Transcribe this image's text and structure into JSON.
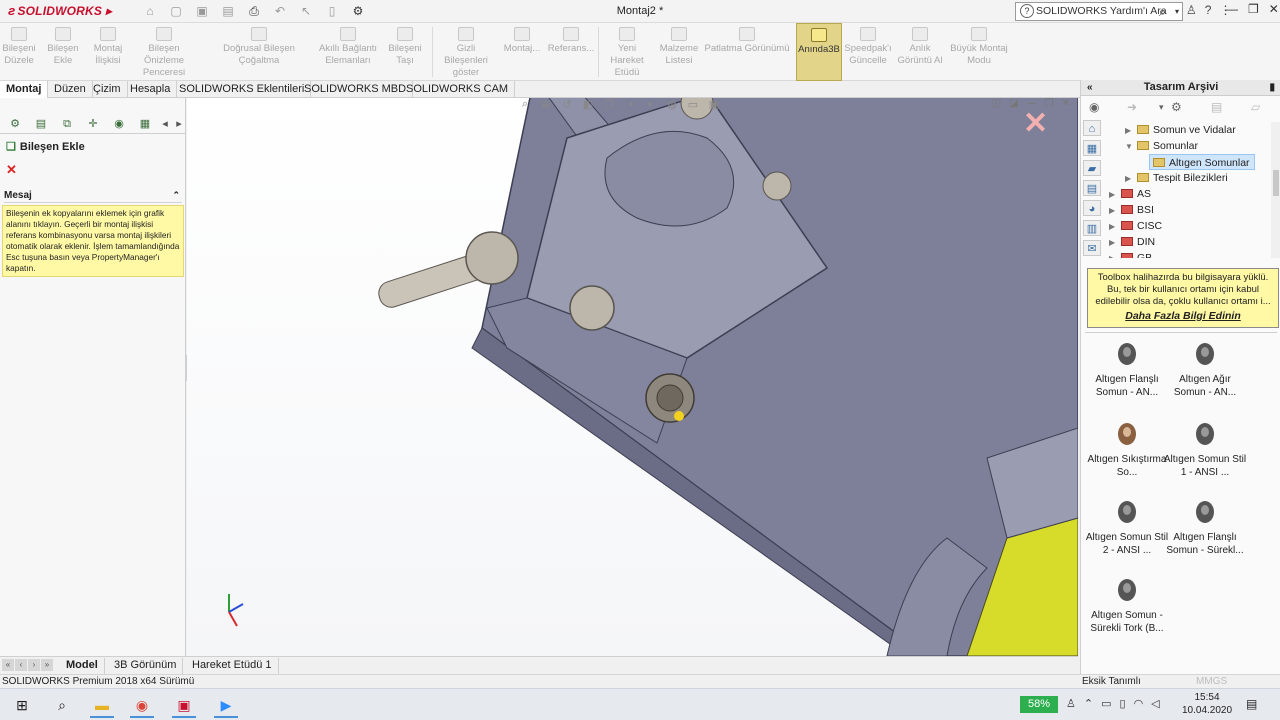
{
  "app": {
    "logo": "SOLIDWORKS",
    "document_title": "Montaj2 *"
  },
  "help": {
    "search_placeholder": "SOLIDWORKS Yardım'ı Ara"
  },
  "ribbon": {
    "buttons": [
      {
        "label": "Bileşeni Düzele"
      },
      {
        "label": "Bileşen Ekle"
      },
      {
        "label": "Montaj İlişkisi"
      },
      {
        "label": "Bileşen Önizleme Penceresi"
      },
      {
        "label": "Doğrusal Bileşen Çoğaltma"
      },
      {
        "label": "Akıllı Bağlantı Elemanları"
      },
      {
        "label": "Bileşeni Taşı"
      },
      {
        "label": "Gizli Bileşenleri göster"
      },
      {
        "label": "Montaj..."
      },
      {
        "label": "Referans..."
      },
      {
        "label": "Yeni Hareket Etüdü"
      },
      {
        "label": "Malzeme Listesi"
      },
      {
        "label": "Patlatma Görünümü"
      },
      {
        "label": "Anında3B"
      },
      {
        "label": "Speedpak'ı Güncelle"
      },
      {
        "label": "Anlık Görüntü Al"
      },
      {
        "label": "Büyük Montaj Modu"
      }
    ]
  },
  "tabs": [
    "Montaj",
    "Düzen",
    "Çizim",
    "Hesapla",
    "SOLIDWORKS Eklentileri",
    "SOLIDWORKS MBD",
    "SOLIDWORKS CAM"
  ],
  "property_manager": {
    "title": "Bileşen Ekle",
    "message_heading": "Mesaj",
    "message": "Bileşenin ek kopyalarını eklemek için grafik alanını tıklayın. Geçerli bir montaj ilişkisi referans kombinasyonu varsa montaj ilişkileri otomatik olarak eklenir. İşlem tamamlandığında Esc tuşuna basın veya PropertyManager'ı kapatın."
  },
  "bottom_tabs": [
    "Model",
    "3B Görünüm",
    "Hareket Etüdü 1"
  ],
  "status": {
    "version": "SOLIDWORKS Premium 2018 x64 Sürümü",
    "definition": "Eksik Tanımlı",
    "units": "MMGS"
  },
  "task_pane": {
    "title": "Tasarım Arşivi",
    "tree": [
      {
        "label": "Somun ve Vidalar",
        "type": "folder",
        "level": 1,
        "expanded": false
      },
      {
        "label": "Somunlar",
        "type": "folder",
        "level": 1,
        "expanded": true
      },
      {
        "label": "Altıgen Somunlar",
        "type": "folder",
        "level": 2,
        "selected": true
      },
      {
        "label": "Tespit Bilezikleri",
        "type": "folder",
        "level": 1,
        "expanded": false
      },
      {
        "label": "AS",
        "type": "standard",
        "level": 0
      },
      {
        "label": "BSI",
        "type": "standard",
        "level": 0
      },
      {
        "label": "CISC",
        "type": "standard",
        "level": 0
      },
      {
        "label": "DIN",
        "type": "standard",
        "level": 0
      },
      {
        "label": "GB",
        "type": "standard",
        "level": 0
      }
    ],
    "toolbox_info": "Toolbox halihazırda bu bilgisayara yüklü. Bu, tek bir kullanıcı ortamı için kabul edilebilir olsa da, çoklu kullanıcı ortamı i...",
    "toolbox_link": "Daha Fazla Bilgi Edinin",
    "parts": [
      {
        "label": "Altıgen Flanşlı Somun - AN..."
      },
      {
        "label": "Altıgen Ağır Somun - AN..."
      },
      {
        "label": "Altıgen Sıkıştırma So..."
      },
      {
        "label": "Altıgen Somun Stil 1 - ANSI ..."
      },
      {
        "label": "Altıgen Somun Stil 2 - ANSI ..."
      },
      {
        "label": "Altıgen Flanşlı Somun - Sürekl..."
      },
      {
        "label": "Altıgen Somun - Sürekli Tork (B..."
      }
    ]
  },
  "taskbar": {
    "battery": "58%",
    "time": "15:54",
    "date": "10.04.2020"
  },
  "colors": {
    "accent": "#c8102e",
    "active_button": "#e2d58a",
    "model_gray": "#7d7f98",
    "model_yellow": "#d7dc2a"
  }
}
